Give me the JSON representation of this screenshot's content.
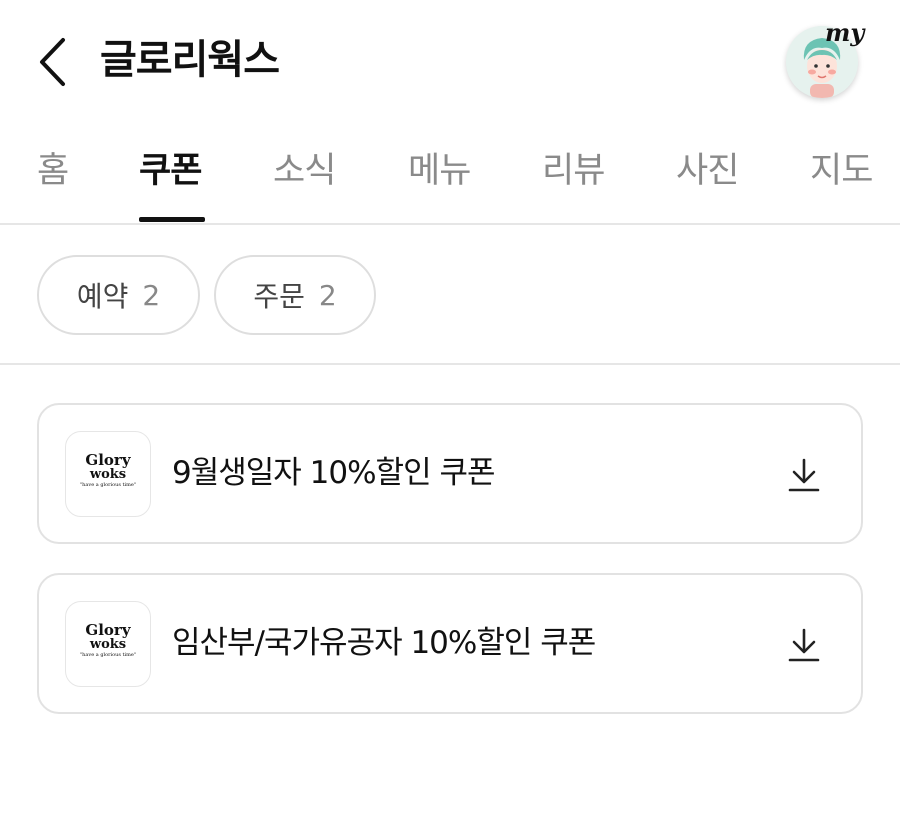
{
  "header": {
    "title": "글로리웍스",
    "my_label": "my"
  },
  "tabs": [
    {
      "label": "홈",
      "active": false
    },
    {
      "label": "쿠폰",
      "active": true
    },
    {
      "label": "소식",
      "active": false
    },
    {
      "label": "메뉴",
      "active": false
    },
    {
      "label": "리뷰",
      "active": false
    },
    {
      "label": "사진",
      "active": false
    },
    {
      "label": "지도",
      "active": false
    }
  ],
  "filters": [
    {
      "label": "예약",
      "count": "2"
    },
    {
      "label": "주문",
      "count": "2"
    }
  ],
  "logo": {
    "line1": "Glory",
    "line2": "woks",
    "line3": "\"have a glorious time\""
  },
  "coupons": [
    {
      "title": "9월생일자 10%할인 쿠폰"
    },
    {
      "title": "임산부/국가유공자 10%할인 쿠폰"
    }
  ],
  "icons": {
    "back": "chevron-left-icon",
    "download": "download-icon",
    "avatar": "avatar-icon"
  },
  "colors": {
    "text": "#111111",
    "inactive_tab": "#8a8a8a",
    "border": "#e2e2e2",
    "avatar_hair": "#6cc3b3"
  }
}
